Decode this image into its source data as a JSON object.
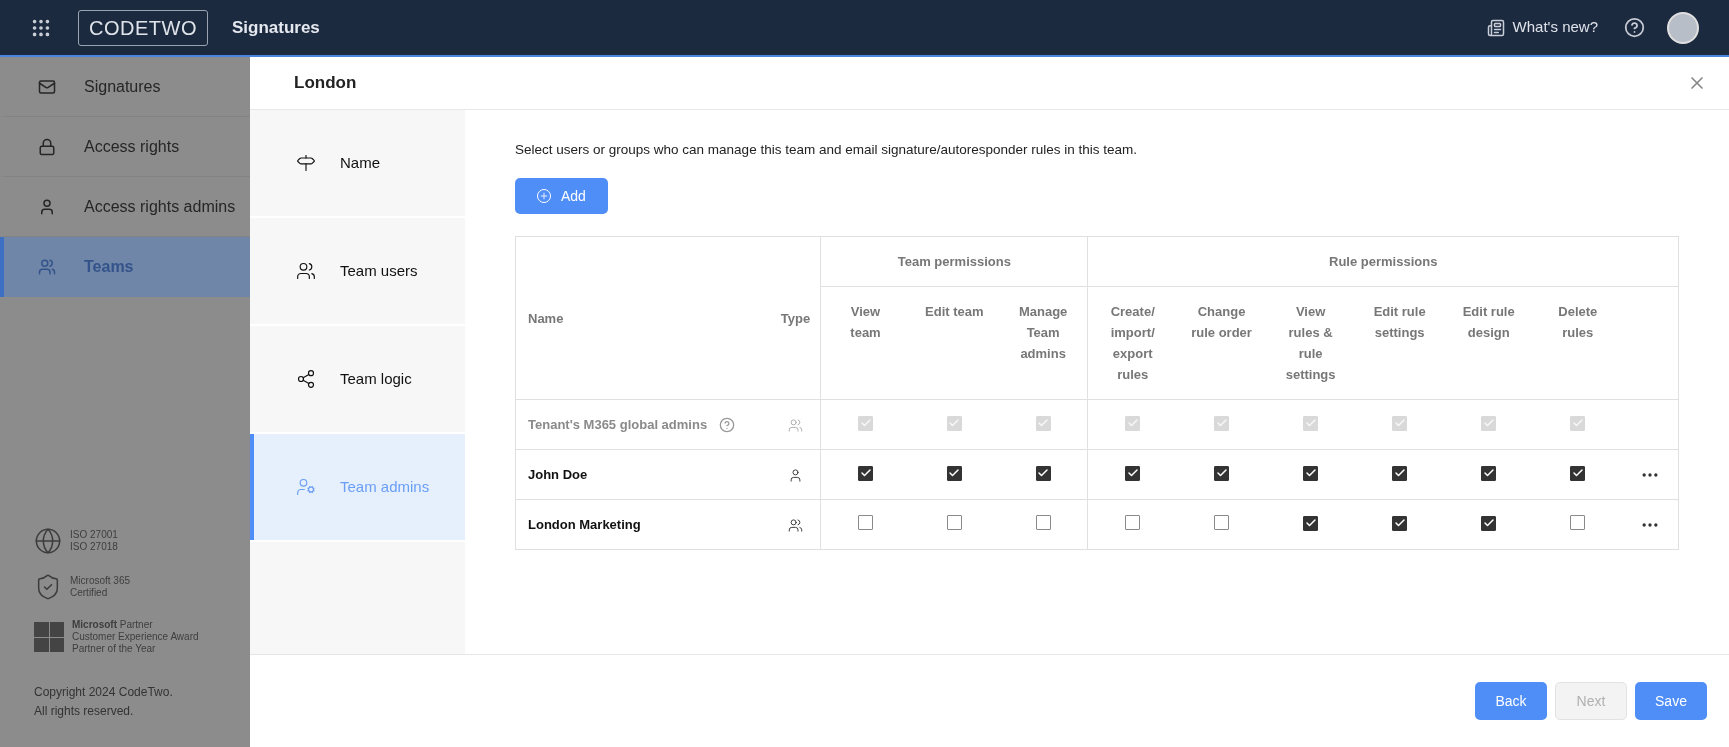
{
  "top_bar": {
    "logo": "CODETWO",
    "app_title": "Signatures",
    "whats_new": "What's new?"
  },
  "sidebar": {
    "items": [
      {
        "label": "Signatures",
        "kind": "signature",
        "selected": false
      },
      {
        "label": "Access rights",
        "kind": "lock",
        "selected": false
      },
      {
        "label": "Access rights admins",
        "kind": "user",
        "selected": false
      },
      {
        "label": "Teams",
        "kind": "team",
        "selected": true
      }
    ],
    "badges": [
      {
        "kind": "iso",
        "lines": [
          "ISO 27001",
          "ISO 27018"
        ]
      },
      {
        "kind": "certified",
        "lines": [
          "Microsoft 365",
          "Certified"
        ]
      },
      {
        "kind": "partner",
        "lines": [
          "**Microsoft** Partner",
          "Customer Experience Award",
          "Partner of the Year"
        ]
      }
    ],
    "copyright": [
      "Copyright 2024 CodeTwo.",
      "All rights reserved."
    ]
  },
  "dialog": {
    "title": "London",
    "steps": [
      {
        "label": "Name",
        "kind": "signpost",
        "selected": false
      },
      {
        "label": "Team users",
        "kind": "users",
        "selected": false
      },
      {
        "label": "Team logic",
        "kind": "logic",
        "selected": false
      },
      {
        "label": "Team admins",
        "kind": "admins",
        "selected": true
      }
    ],
    "description": "Select users or groups who can manage this team and email signature/autoresponder rules in this team.",
    "add_button": "Add",
    "table": {
      "name_header": "Name",
      "type_header": "Type",
      "groups": [
        {
          "label": "Team permissions",
          "columns": [
            "View team",
            "Edit team",
            "Manage Team admins"
          ]
        },
        {
          "label": "Rule permissions",
          "columns": [
            "Create/ import/ export rules",
            "Change rule order",
            "View rules & rule settings",
            "Edit rule settings",
            "Edit rule design",
            "Delete rules"
          ]
        }
      ],
      "rows": [
        {
          "name": "Tenant's M365 global admins",
          "kind": "group",
          "disabled": true,
          "help": true,
          "menu": false,
          "permissions": [
            true,
            true,
            true,
            true,
            true,
            true,
            true,
            true,
            true
          ]
        },
        {
          "name": "John Doe",
          "kind": "user",
          "disabled": false,
          "help": false,
          "menu": true,
          "permissions": [
            true,
            true,
            true,
            true,
            true,
            true,
            true,
            true,
            true
          ]
        },
        {
          "name": "London Marketing",
          "kind": "group",
          "disabled": false,
          "help": false,
          "menu": true,
          "permissions": [
            false,
            false,
            false,
            false,
            false,
            true,
            true,
            true,
            false
          ]
        }
      ]
    },
    "buttons": [
      {
        "label": "Back",
        "disabled": false
      },
      {
        "label": "Next",
        "disabled": true
      },
      {
        "label": "Save",
        "disabled": false
      }
    ]
  }
}
